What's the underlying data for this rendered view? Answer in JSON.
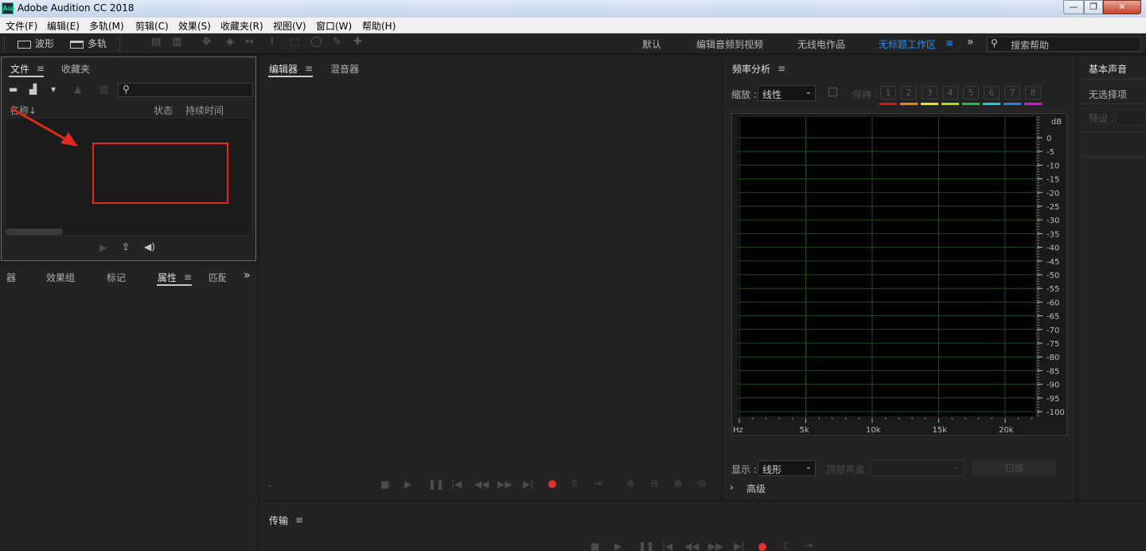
{
  "window": {
    "title": "Adobe Audition CC 2018",
    "app_icon_text": "Au",
    "controls": {
      "minimize": "—",
      "maximize": "❐",
      "close": "✕"
    }
  },
  "menu": [
    "文件(F)",
    "编辑(E)",
    "多轨(M)",
    "剪辑(C)",
    "效果(S)",
    "收藏夹(R)",
    "视图(V)",
    "窗口(W)",
    "帮助(H)"
  ],
  "toolbar": {
    "waveform_label": "波形",
    "multitrack_label": "多轨",
    "workspaces": [
      "默认",
      "编辑音频到视频",
      "无线电作品",
      "无标题工作区"
    ],
    "more": "»",
    "search_placeholder": "搜索帮助"
  },
  "files_panel": {
    "tabs": [
      "文件",
      "收藏夹"
    ],
    "menu_glyph": "≡",
    "columns": [
      "名称",
      "状态",
      "持续时间"
    ],
    "sort_glyph": "↓"
  },
  "props_panel": {
    "tabs": [
      "器",
      "效果组",
      "标记",
      "属性",
      "匹配"
    ],
    "active_tab": "属性",
    "more": "»"
  },
  "editor_panel": {
    "tabs": [
      "编辑器",
      "混音器"
    ],
    "dash": "-"
  },
  "transport_panel": {
    "title": "传输"
  },
  "freq_panel": {
    "title": "频率分析",
    "zoom_label": "缩放 :",
    "zoom_value": "线性",
    "hold_label": "保持 :",
    "hold_slots": [
      "1",
      "2",
      "3",
      "4",
      "5",
      "6",
      "7",
      "8"
    ],
    "hold_colors": [
      "#e01010",
      "#f08010",
      "#f0e010",
      "#a0e010",
      "#20c040",
      "#10d0e0",
      "#2080f0",
      "#e010e0"
    ],
    "db_unit": "dB",
    "db_ticks": [
      "0",
      "-5",
      "-10",
      "-15",
      "-20",
      "-25",
      "-30",
      "-35",
      "-40",
      "-45",
      "-50",
      "-55",
      "-60",
      "-65",
      "-70",
      "-75",
      "-80",
      "-85",
      "-90",
      "-95",
      "-100"
    ],
    "freq_ticks": [
      "Hz",
      "5k",
      "10k",
      "15k",
      "20k"
    ],
    "display_label": "显示 :",
    "display_value": "线形",
    "channel_label": "顶部声道 :",
    "scan_button": "扫描",
    "advanced_label": "高级"
  },
  "basic_panel": {
    "title": "基本声音",
    "no_selection": "无选择项",
    "preset_label": "预设 :"
  },
  "colors": {
    "accent_blue": "#2d8ceb",
    "record_red": "#e03030",
    "annotation_red": "#e0281e",
    "panel_bg": "#232323",
    "grid_green": "#1e4d1e"
  }
}
